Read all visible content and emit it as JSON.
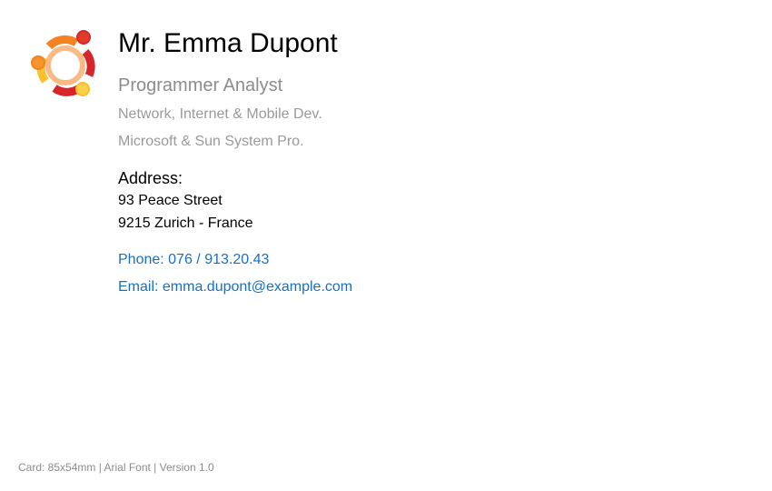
{
  "card": {
    "logo_icon": "ubuntu-circle-of-friends-icon",
    "colors": {
      "logo_red": "#d7262a",
      "logo_orange": "#f58220",
      "logo_yellow": "#fbc02d",
      "link_blue": "#1a6fbd",
      "muted_gray": "#9a9a9a"
    },
    "name": "Mr. Emma Dupont",
    "job_title": "Programmer Analyst",
    "skills": [
      "Network, Internet & Mobile Dev.",
      "Microsoft & Sun System Pro."
    ],
    "address": {
      "heading": "Address:",
      "line1": "93 Peace Street",
      "line2": "9215 Zurich - France"
    },
    "contact": {
      "phone": "Phone: 076 / 913.20.43",
      "email": "Email: emma.dupont@example.com"
    }
  },
  "footer": {
    "text": "Card: 85x54mm | Arial Font | Version 1.0"
  }
}
